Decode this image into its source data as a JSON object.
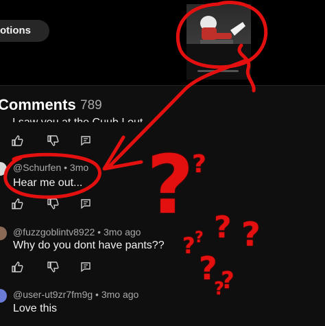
{
  "top": {
    "options_label": "otions"
  },
  "comments": {
    "title": "Comments",
    "count": "789",
    "cut_off_text": "I saw you at the Cuub I out",
    "items": [
      {
        "author_meta": "@Schurfen • 3mo",
        "text": "Hear me out...",
        "avatar_color": "#d9d9d9"
      },
      {
        "author_meta": "@fuzzgoblintv8922 • 3mo ago",
        "text": "Why do you dont have pants??",
        "avatar_color": "#8a6a55"
      },
      {
        "author_meta": "@user-ut9zr7fm9g • 3mo ago",
        "text": "Love this",
        "avatar_color": "#6a7bd8"
      }
    ]
  },
  "colors": {
    "annotation_red": "#e41010",
    "background": "#0f0f0f"
  },
  "icons": [
    "like-icon",
    "dislike-icon",
    "reply-icon"
  ]
}
